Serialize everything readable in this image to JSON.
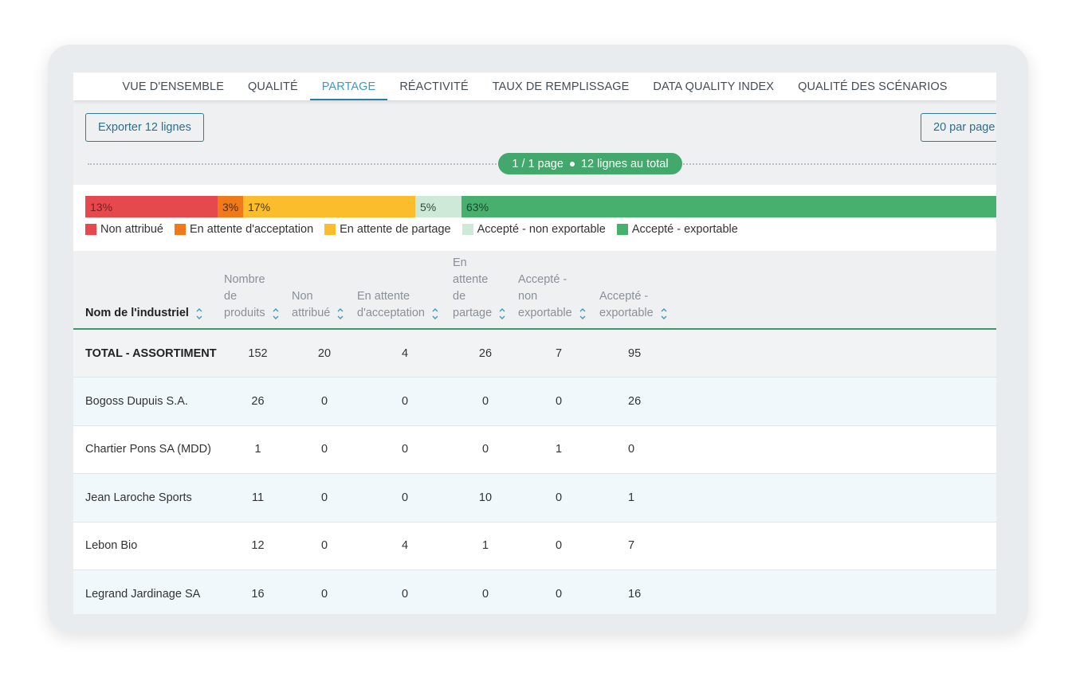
{
  "tabs": [
    {
      "label": "VUE D'ENSEMBLE",
      "active": false
    },
    {
      "label": "QUALITÉ",
      "active": false
    },
    {
      "label": "PARTAGE",
      "active": true
    },
    {
      "label": "RÉACTIVITÉ",
      "active": false
    },
    {
      "label": "TAUX DE REMPLISSAGE",
      "active": false
    },
    {
      "label": "DATA QUALITY INDEX",
      "active": false
    },
    {
      "label": "QUALITÉ DES SCÉNARIOS",
      "active": false
    }
  ],
  "toolbar": {
    "export_label": "Exporter 12 lignes",
    "per_page_label": "20 par page"
  },
  "pager": {
    "page_text": "1 / 1 page",
    "total_text": "12 lignes au total"
  },
  "distribution": {
    "segments": [
      {
        "label": "13%",
        "percent": 13,
        "color": "#e5484d",
        "text_color": "#7a1f22"
      },
      {
        "label": "3%",
        "percent": 3,
        "color": "#ef7a1a",
        "text_color": "#5a2a05"
      },
      {
        "label": "17%",
        "percent": 17,
        "color": "#fbbd2b",
        "text_color": "#4a3a05"
      },
      {
        "label": "5%",
        "percent": 5,
        "color": "#cfe9d8",
        "text_color": "#2e4a38"
      },
      {
        "label": "63%",
        "percent": 63,
        "color": "#47b06f",
        "text_color": "#134a28"
      }
    ],
    "legend": [
      {
        "label": "Non attribué",
        "color": "#e5484d"
      },
      {
        "label": "En attente d'acceptation",
        "color": "#ef7a1a"
      },
      {
        "label": "En attente de partage",
        "color": "#fbbd2b"
      },
      {
        "label": "Accepté - non exportable",
        "color": "#cfe9d8"
      },
      {
        "label": "Accepté - exportable",
        "color": "#47b06f"
      }
    ]
  },
  "table": {
    "headers": [
      "Nom de l'industriel",
      "Nombre de produits",
      "Non attribué",
      "En attente d'acceptation",
      "En attente de partage",
      "Accepté - non exportable",
      "Accepté - exportable"
    ],
    "header_lines": [
      [
        "Nom de l'industriel"
      ],
      [
        "Nombre",
        "de",
        "produits"
      ],
      [
        "Non",
        "attribué"
      ],
      [
        "En attente",
        "d'acceptation"
      ],
      [
        "En",
        "attente",
        "de",
        "partage"
      ],
      [
        "Accepté -",
        "non",
        "exportable"
      ],
      [
        "Accepté -",
        "exportable"
      ]
    ],
    "rows": [
      [
        "TOTAL - ASSORTIMENT",
        "152",
        "20",
        "4",
        "26",
        "7",
        "95"
      ],
      [
        "Bogoss Dupuis S.A.",
        "26",
        "0",
        "0",
        "0",
        "0",
        "26"
      ],
      [
        "Chartier Pons SA (MDD)",
        "1",
        "0",
        "0",
        "0",
        "1",
        "0"
      ],
      [
        "Jean Laroche Sports",
        "11",
        "0",
        "0",
        "10",
        "0",
        "1"
      ],
      [
        "Lebon Bio",
        "12",
        "0",
        "4",
        "1",
        "0",
        "7"
      ],
      [
        "Legrand Jardinage SA",
        "16",
        "0",
        "0",
        "0",
        "0",
        "16"
      ]
    ]
  }
}
